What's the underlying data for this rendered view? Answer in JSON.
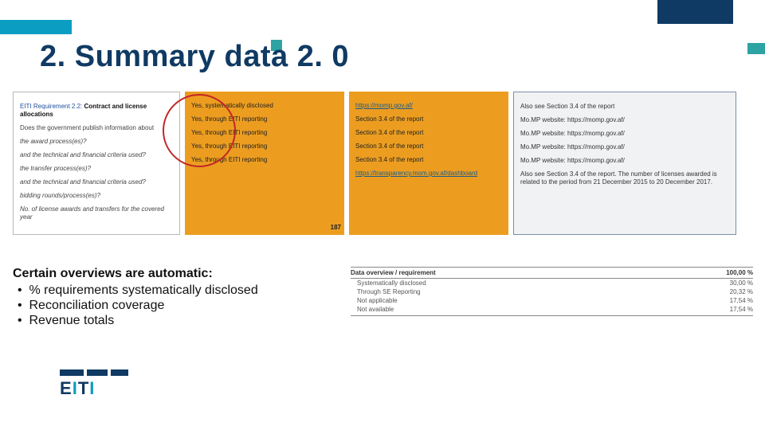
{
  "title": "2. Summary data 2. 0",
  "panel1": {
    "header_prefix": "EITI Requirement 2.2:",
    "header_label": "Contract and license allocations",
    "lead": "Does the government publish information about",
    "rows": [
      "the award process(es)?",
      "and the technical and financial criteria used?",
      "the transfer process(es)?",
      "and the technical and financial criteria used?",
      "bidding rounds/process(es)?",
      "No. of license awards and transfers for the covered year"
    ]
  },
  "panel2": {
    "rows": [
      "Yes, systematically disclosed",
      "Yes, through EITI reporting",
      "Yes, through EITI reporting",
      "Yes, through EITI reporting",
      "Yes, through EITI reporting"
    ],
    "counter": "187"
  },
  "panel3": {
    "rows": [
      {
        "text": "https://momp.gov.af/",
        "link": true
      },
      {
        "text": "Section 3.4 of the report",
        "link": false
      },
      {
        "text": "Section 3.4 of the report",
        "link": false
      },
      {
        "text": "Section 3.4 of the report",
        "link": false
      },
      {
        "text": "Section 3.4 of the report",
        "link": false
      },
      {
        "text": "https://transparency.mom.gov.af/dashboard",
        "link": true
      }
    ]
  },
  "panel4": {
    "rows": [
      "Also see Section 3.4 of the report",
      "Mo.MP website: https://momp.gov.af/",
      "Mo.MP website: https://momp.gov.af/",
      "Mo.MP website: https://momp.gov.af/",
      "Mo.MP website: https://momp.gov.af/",
      "Also see Section 3.4 of the report. The number of licenses awarded is related to the period from 21 December 2015 to 20 December 2017."
    ]
  },
  "lower": {
    "heading": "Certain overviews are automatic:",
    "bullets": [
      "% requirements systematically disclosed",
      "Reconciliation coverage",
      "Revenue totals"
    ]
  },
  "overview": {
    "header_left": "Data overview / requirement",
    "header_right": "100,00 %",
    "rows": [
      {
        "label": "Systematically disclosed",
        "value": "30,00 %"
      },
      {
        "label": "Through SE Reporting",
        "value": "20,32 %"
      },
      {
        "label": "Not applicable",
        "value": "17,54 %"
      },
      {
        "label": "Not available",
        "value": "17,54 %"
      }
    ]
  },
  "logo_text": "EITI"
}
